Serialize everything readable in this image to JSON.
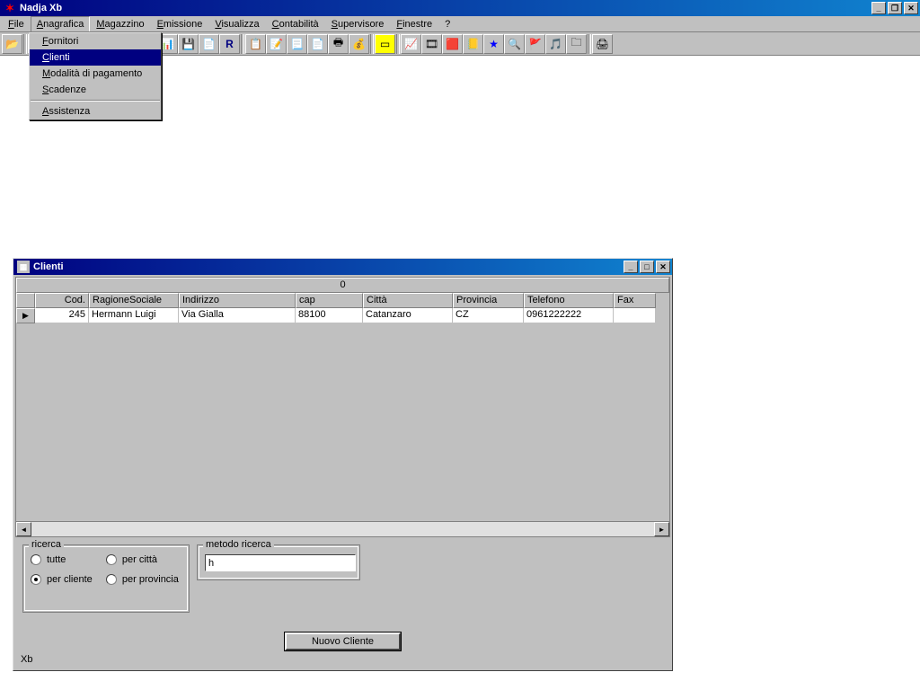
{
  "app": {
    "title": "Nadja Xb"
  },
  "menubar": {
    "items": [
      {
        "label": "File",
        "ul": "F"
      },
      {
        "label": "Anagrafica",
        "ul": "A"
      },
      {
        "label": "Magazzino",
        "ul": "M"
      },
      {
        "label": "Emissione",
        "ul": "E"
      },
      {
        "label": "Visualizza",
        "ul": "V"
      },
      {
        "label": "Contabilità",
        "ul": "C"
      },
      {
        "label": "Supervisore",
        "ul": "S"
      },
      {
        "label": "Finestre",
        "ul": "F"
      },
      {
        "label": "?",
        "ul": ""
      }
    ]
  },
  "dropdown": {
    "items": [
      {
        "label": "Fornitori",
        "ul": "F",
        "selected": false
      },
      {
        "label": "Clienti",
        "ul": "C",
        "selected": true
      },
      {
        "label": "Modalità di pagamento",
        "ul": "M",
        "selected": false
      },
      {
        "label": "Scadenze",
        "ul": "S",
        "selected": false
      }
    ],
    "sep_after": 3,
    "items2": [
      {
        "label": "Assistenza",
        "ul": "A",
        "selected": false
      }
    ]
  },
  "child": {
    "title": "Clienti",
    "top_header": "0",
    "columns": [
      "Cod.",
      "RagioneSociale",
      "Indirizzo",
      "cap",
      "Città",
      "Provincia",
      "Telefono",
      "Fax"
    ],
    "rows": [
      {
        "cod": "245",
        "rag": "Hermann Luigi",
        "ind": "Via Gialla",
        "cap": "88100",
        "cit": "Catanzaro",
        "pro": "CZ",
        "tel": "0961222222",
        "fax": ""
      }
    ]
  },
  "search": {
    "ricerca_legend": "ricerca",
    "metodo_legend": "metodo ricerca",
    "options": {
      "tutte": "tutte",
      "per_citta": "per città",
      "per_cliente": "per cliente",
      "per_provincia": "per provincia"
    },
    "selected": "per_cliente",
    "input_value": "h"
  },
  "buttons": {
    "nuovo_cliente": "Nuovo Cliente"
  },
  "status": {
    "text": "Xb"
  }
}
